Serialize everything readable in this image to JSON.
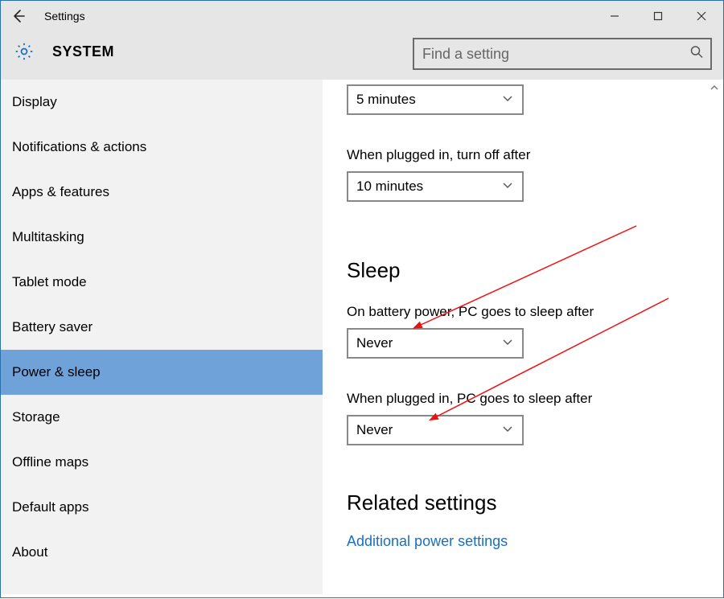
{
  "titlebar": {
    "title": "Settings"
  },
  "header": {
    "system": "SYSTEM",
    "search_placeholder": "Find a setting"
  },
  "sidebar": {
    "items": [
      "Display",
      "Notifications & actions",
      "Apps & features",
      "Multitasking",
      "Tablet mode",
      "Battery saver",
      "Power & sleep",
      "Storage",
      "Offline maps",
      "Default apps",
      "About"
    ],
    "active_index": 6
  },
  "content": {
    "screen_off_battery_value": "5 minutes",
    "screen_off_plugged_label": "When plugged in, turn off after",
    "screen_off_plugged_value": "10 minutes",
    "sleep_heading": "Sleep",
    "sleep_battery_label": "On battery power, PC goes to sleep after",
    "sleep_battery_value": "Never",
    "sleep_plugged_label": "When plugged in, PC goes to sleep after",
    "sleep_plugged_value": "Never",
    "related_heading": "Related settings",
    "related_link": "Additional power settings"
  }
}
